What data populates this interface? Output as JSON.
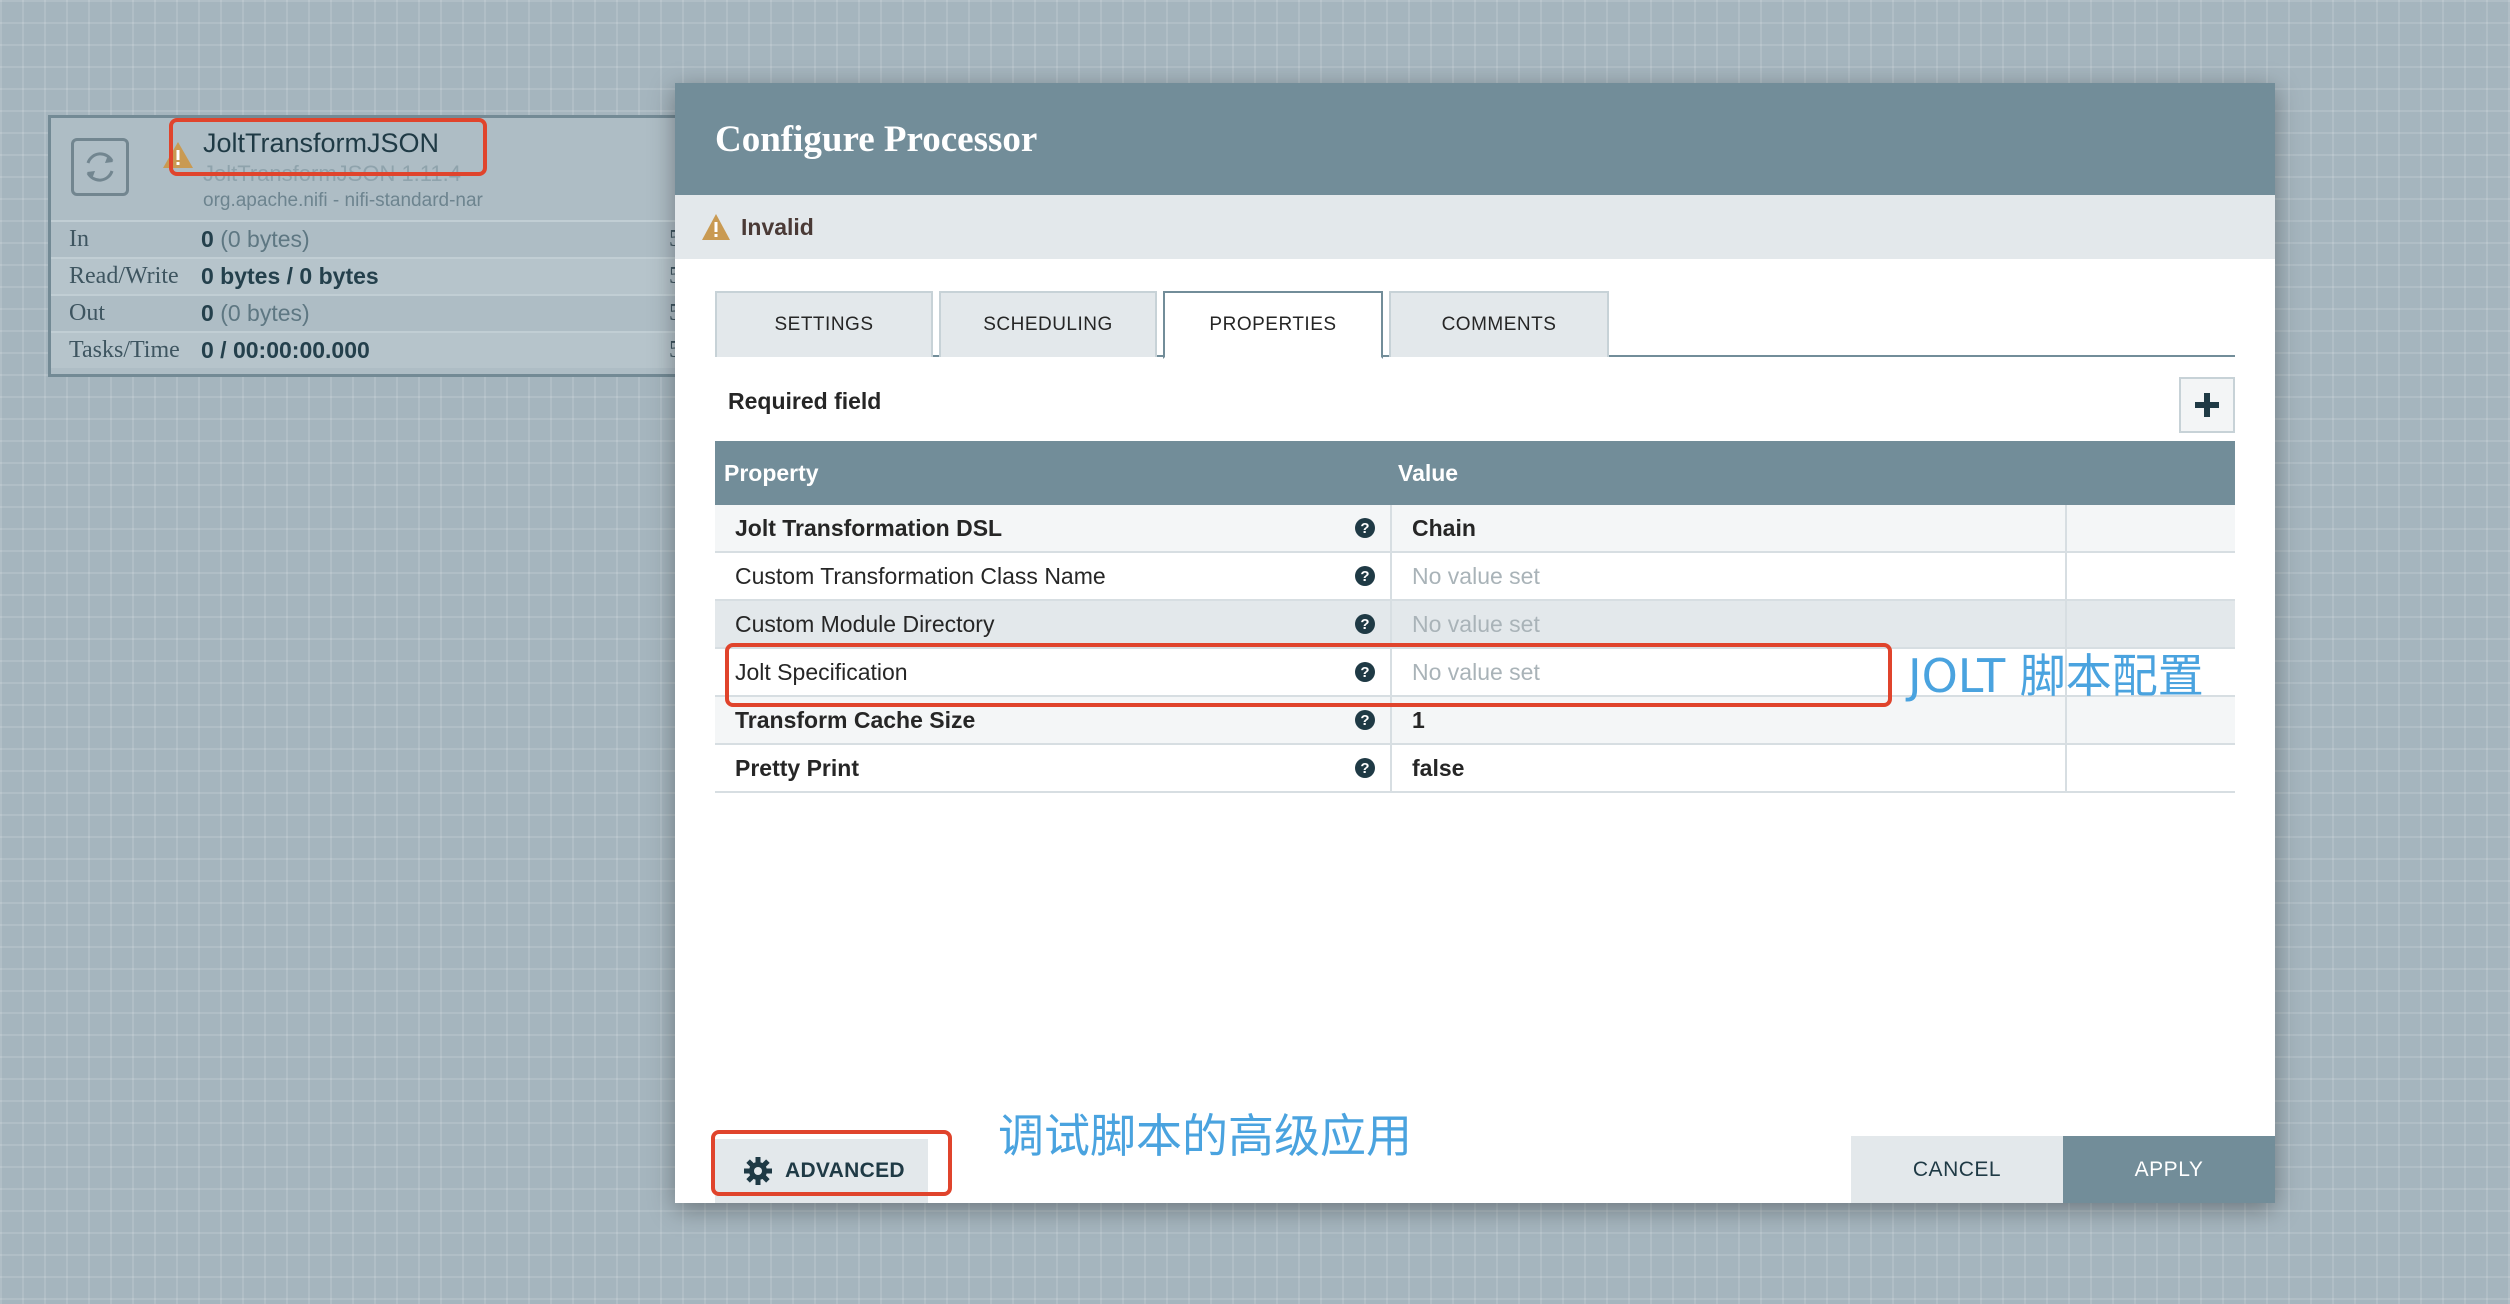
{
  "node": {
    "name": "JoltTransformJSON",
    "version": "JoltTransformJSON 1.11.4",
    "bundle": "org.apache.nifi - nifi-standard-nar",
    "stats": [
      {
        "label": "In",
        "value": "0",
        "detail": "(0 bytes)",
        "tail": "5"
      },
      {
        "label": "Read/Write",
        "value": "0 bytes / 0 bytes",
        "detail": "",
        "tail": "5"
      },
      {
        "label": "Out",
        "value": "0",
        "detail": "(0 bytes)",
        "tail": "5"
      },
      {
        "label": "Tasks/Time",
        "value": "0 / 00:00:00.000",
        "detail": "",
        "tail": "5"
      }
    ]
  },
  "dialog": {
    "title": "Configure Processor",
    "status": "Invalid",
    "tabs": [
      "SETTINGS",
      "SCHEDULING",
      "PROPERTIES",
      "COMMENTS"
    ],
    "active_tab": "PROPERTIES",
    "required_label": "Required field",
    "table": {
      "headers": {
        "property": "Property",
        "value": "Value"
      },
      "rows": [
        {
          "name": "Jolt Transformation DSL",
          "value": "Chain"
        },
        {
          "name": "Custom Transformation Class Name",
          "value": "No value set"
        },
        {
          "name": "Custom Module Directory",
          "value": "No value set"
        },
        {
          "name": "Jolt Specification",
          "value": "No value set"
        },
        {
          "name": "Transform Cache Size",
          "value": "1"
        },
        {
          "name": "Pretty Print",
          "value": "false"
        }
      ]
    },
    "buttons": {
      "advanced": "ADVANCED",
      "cancel": "CANCEL",
      "apply": "APPLY"
    }
  },
  "annotations": {
    "jolt_config": "JOLT 脚本配置",
    "advanced_debug": "调试脚本的高级应用"
  },
  "colors": {
    "header": "#728d99",
    "annotation_box": "#e0442c",
    "annotation_text": "#4aa3df",
    "warning": "#c99a52"
  }
}
